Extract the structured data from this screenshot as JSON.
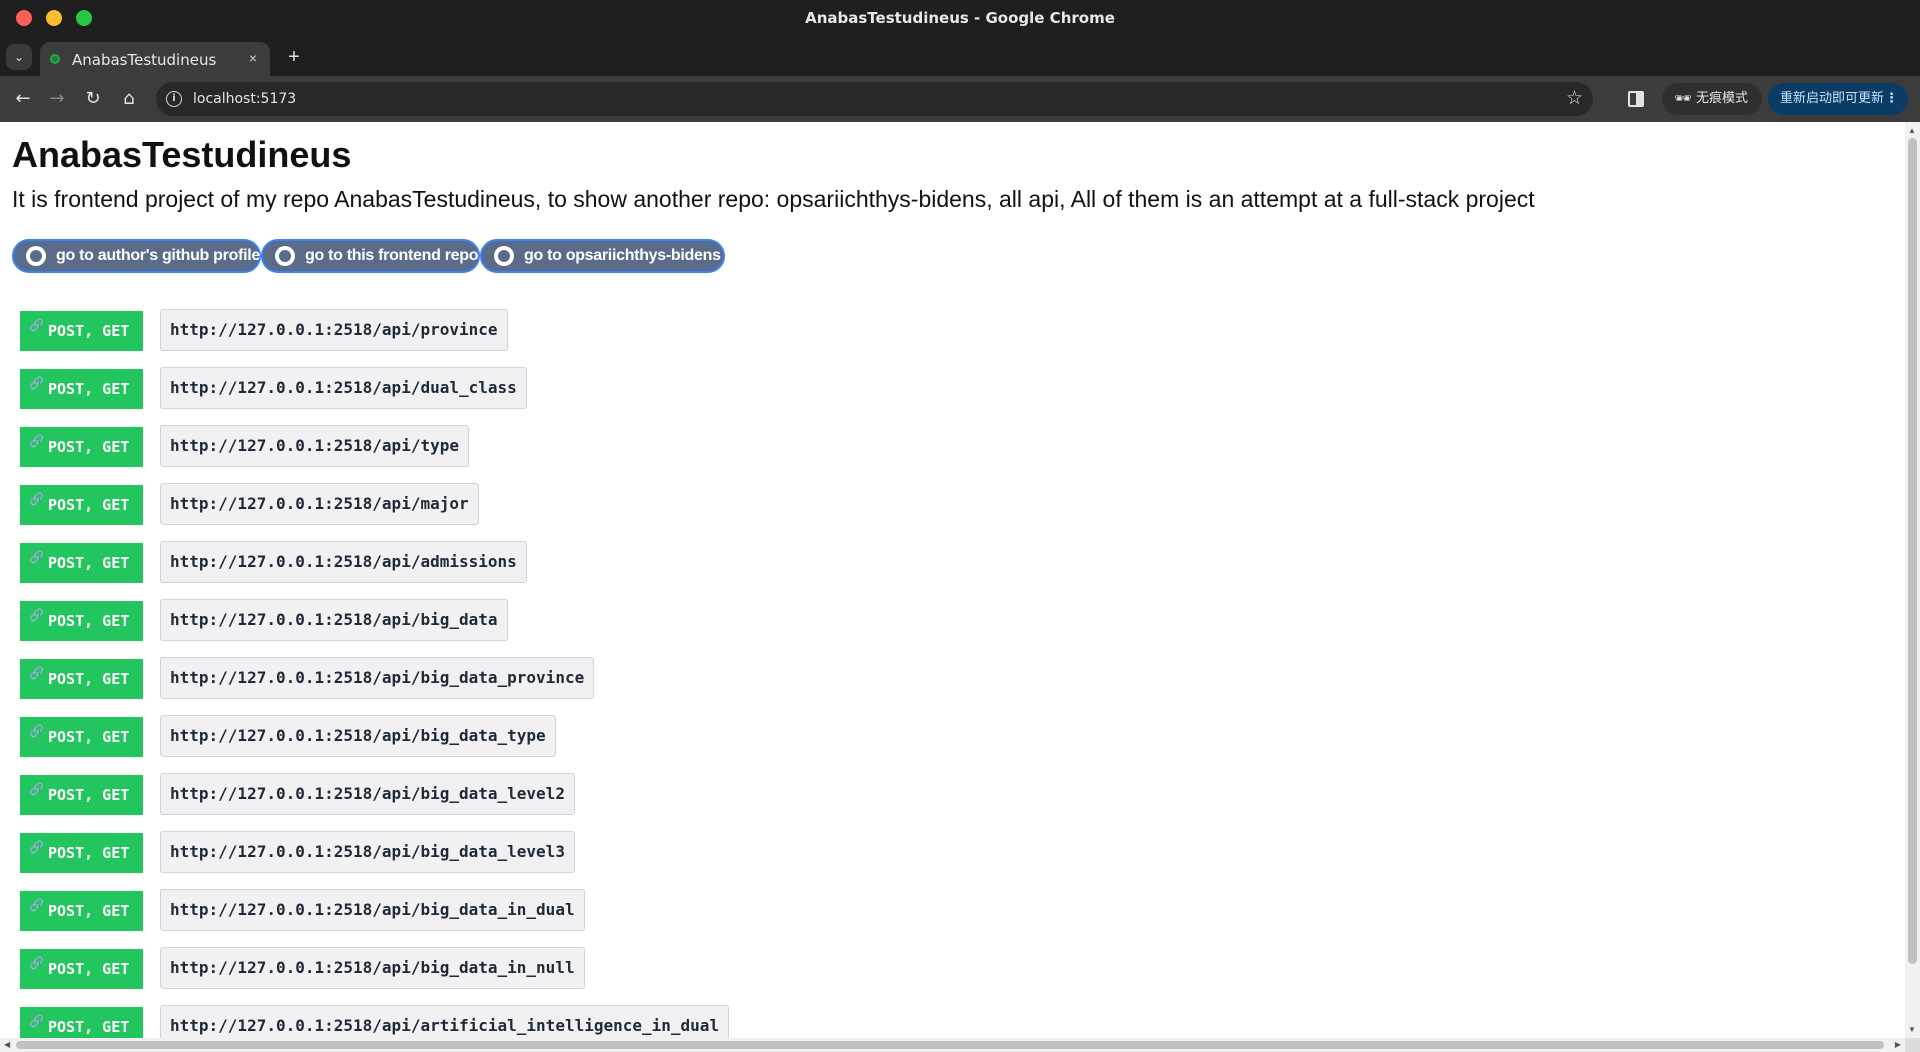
{
  "window": {
    "title": "AnabasTestudineus - Google Chrome"
  },
  "tabs": [
    {
      "title": "AnabasTestudineus",
      "close": "×"
    }
  ],
  "tabstrip": {
    "tab_search": "⌄",
    "new_tab": "+"
  },
  "toolbar": {
    "back": "←",
    "forward": "→",
    "reload": "↻",
    "home": "⌂",
    "url": "localhost:5173",
    "info_icon": "i",
    "star": "☆",
    "incognito_icon": "🕶",
    "incognito_label": "无痕模式",
    "update_label": "重新启动即可更新",
    "update_menu": "⋮"
  },
  "page": {
    "title": "AnabasTestudineus",
    "description": "It is frontend project of my repo AnabasTestudineus, to show another repo: opsariichthys-bidens, all api, All of them is an attempt at a full-stack project",
    "links": [
      {
        "label": "go to author's github profile"
      },
      {
        "label": "go to this frontend repo"
      },
      {
        "label": "go to opsariichthys-bidens"
      }
    ],
    "apis": [
      {
        "method": "POST, GET",
        "url": "http://127.0.0.1:2518/api/province"
      },
      {
        "method": "POST, GET",
        "url": "http://127.0.0.1:2518/api/dual_class"
      },
      {
        "method": "POST, GET",
        "url": "http://127.0.0.1:2518/api/type"
      },
      {
        "method": "POST, GET",
        "url": "http://127.0.0.1:2518/api/major"
      },
      {
        "method": "POST, GET",
        "url": "http://127.0.0.1:2518/api/admissions"
      },
      {
        "method": "POST, GET",
        "url": "http://127.0.0.1:2518/api/big_data"
      },
      {
        "method": "POST, GET",
        "url": "http://127.0.0.1:2518/api/big_data_province"
      },
      {
        "method": "POST, GET",
        "url": "http://127.0.0.1:2518/api/big_data_type"
      },
      {
        "method": "POST, GET",
        "url": "http://127.0.0.1:2518/api/big_data_level2"
      },
      {
        "method": "POST, GET",
        "url": "http://127.0.0.1:2518/api/big_data_level3"
      },
      {
        "method": "POST, GET",
        "url": "http://127.0.0.1:2518/api/big_data_in_dual"
      },
      {
        "method": "POST, GET",
        "url": "http://127.0.0.1:2518/api/big_data_in_null"
      },
      {
        "method": "POST, GET",
        "url": "http://127.0.0.1:2518/api/artificial_intelligence_in_dual"
      }
    ],
    "link_icon": "🔗"
  },
  "colors": {
    "badge_green": "#22c55e",
    "button_fill": "#5a6c8a",
    "button_border": "#3b82f6",
    "chrome_dark": "#1f1f1f"
  }
}
